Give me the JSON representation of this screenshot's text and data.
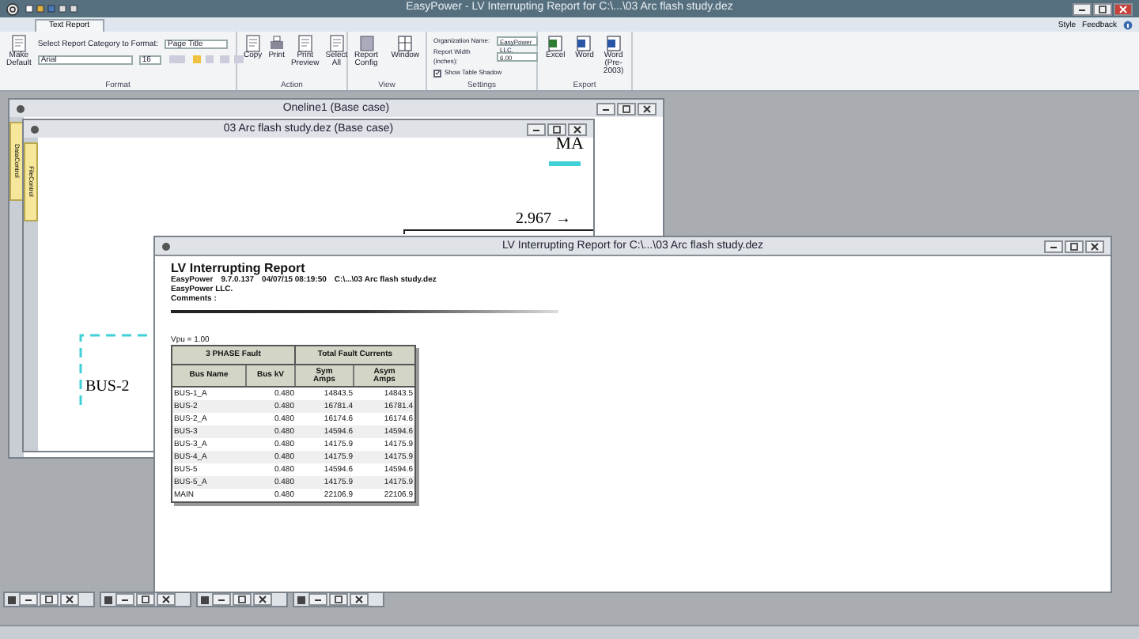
{
  "window": {
    "title": "EasyPower - LV Interrupting Report for C:\\...\\03 Arc flash study.dez"
  },
  "ribbon_tabs": [
    {
      "label": "Text Report",
      "selected": true
    }
  ],
  "ribbon_right": [
    "Style",
    "Feedback"
  ],
  "format_group": {
    "label": "Format",
    "make_default": "Make Default",
    "category_label": "Select Report Category to Format:",
    "category_value": "Page Title",
    "font": "Arial",
    "font_size": "16"
  },
  "action_group": {
    "label": "Action",
    "buttons": [
      "Copy",
      "Print",
      "Print Preview",
      "Select All"
    ]
  },
  "view_group": {
    "label": "View",
    "buttons": [
      "Report Config",
      "Window"
    ]
  },
  "settings_group": {
    "label": "Settings",
    "org_label": "Organization Name:",
    "org_value": "EasyPower LLC.",
    "width_label": "Report Width (inches):",
    "width_value": "6.00",
    "shadow": {
      "label": "Show Table Shadow",
      "checked": true
    }
  },
  "export_group": {
    "label": "Export",
    "buttons": [
      "Excel",
      "Word",
      "Word (Pre-2003)"
    ]
  },
  "oneline_window": {
    "title": "Oneline1  (Base case)",
    "side_tab": "DataControl"
  },
  "study_window": {
    "title": "03 Arc flash study.dez  (Base case)",
    "side_tab": "FileControl",
    "labels": [
      "MA",
      "2.967 →",
      "BUS-2"
    ]
  },
  "report_window": {
    "title": "LV Interrupting Report for C:\\...\\03 Arc flash study.dez",
    "heading": "LV Interrupting Report",
    "info": [
      "EasyPower",
      "9.7.0.137",
      "04/07/15 08:19:50",
      "C:\\...\\03 Arc flash study.dez"
    ],
    "company": "EasyPower LLC.",
    "comments": "Comments :",
    "vpu": "Vpu = 1.00",
    "table": {
      "group_headers": [
        "3 PHASE Fault",
        "Total Fault Currents"
      ],
      "columns": [
        "Bus Name",
        "Bus kV",
        "Sym Amps",
        "Asym Amps"
      ],
      "rows": [
        [
          "BUS-1_A",
          "0.480",
          "14843.5",
          "14843.5"
        ],
        [
          "BUS-2",
          "0.480",
          "16781.4",
          "16781.4"
        ],
        [
          "BUS-2_A",
          "0.480",
          "16174.6",
          "16174.6"
        ],
        [
          "BUS-3",
          "0.480",
          "14594.6",
          "14594.6"
        ],
        [
          "BUS-3_A",
          "0.480",
          "14175.9",
          "14175.9"
        ],
        [
          "BUS-4_A",
          "0.480",
          "14175.9",
          "14175.9"
        ],
        [
          "BUS-5",
          "0.480",
          "14594.6",
          "14594.6"
        ],
        [
          "BUS-5_A",
          "0.480",
          "14175.9",
          "14175.9"
        ],
        [
          "MAIN",
          "0.480",
          "22106.9",
          "22106.9"
        ]
      ]
    }
  }
}
